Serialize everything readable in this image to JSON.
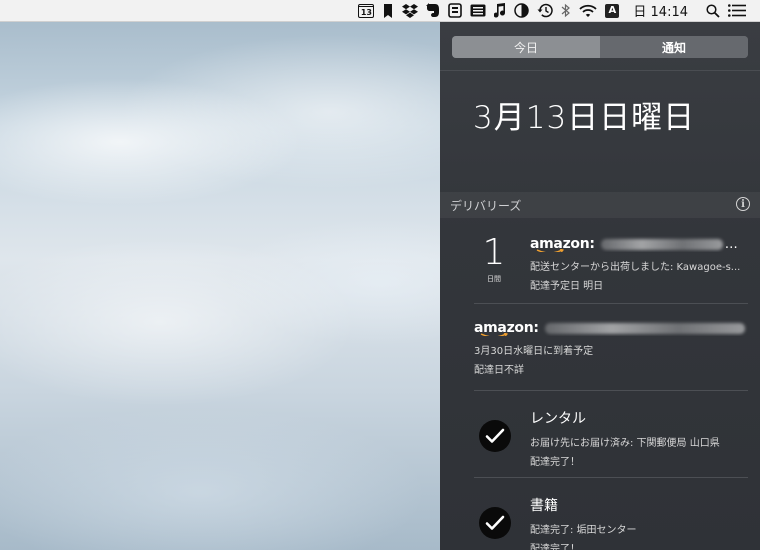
{
  "menubar": {
    "calendar_day": "13",
    "input_source": "A",
    "clock": "日 14:14",
    "icons": [
      "calendar-icon",
      "bookmark-icon",
      "dropbox-icon",
      "evernote-icon",
      "clipboard-icon",
      "keyboard-icon",
      "music-note-icon",
      "contrast-icon",
      "time-machine-icon",
      "bluetooth-icon",
      "wifi-icon",
      "input-source-icon",
      "spotlight-search-icon",
      "notification-center-icon"
    ]
  },
  "notification_center": {
    "tabs": [
      {
        "label": "今日",
        "active": false
      },
      {
        "label": "通知",
        "active": true
      }
    ],
    "date_heading": "3月13日日曜日",
    "section": {
      "title": "デリバリーズ",
      "info_icon": "i"
    },
    "items": [
      {
        "countdown_number": "1",
        "countdown_unit": "日間",
        "brand": "amazon:",
        "ellipsis": "…",
        "line1": "配送センターから出荷しました: Kawagoe-s...",
        "line2": "配達予定日 明日"
      },
      {
        "brand": "amazon:",
        "line1": "3月30日水曜日に到着予定",
        "line2": "配達日不詳"
      },
      {
        "title": "レンタル",
        "line1": "お届け先にお届け済み: 下関郵便局 山口県",
        "line2": "配達完了！"
      },
      {
        "title": "書籍",
        "line1": "配達完了: 垢田センター",
        "line2": "配達完了！"
      }
    ]
  },
  "colors": {
    "panel_bg": "#34373c",
    "menubar_bg": "#f2f2f2",
    "check_bg": "#0a0a0a"
  }
}
